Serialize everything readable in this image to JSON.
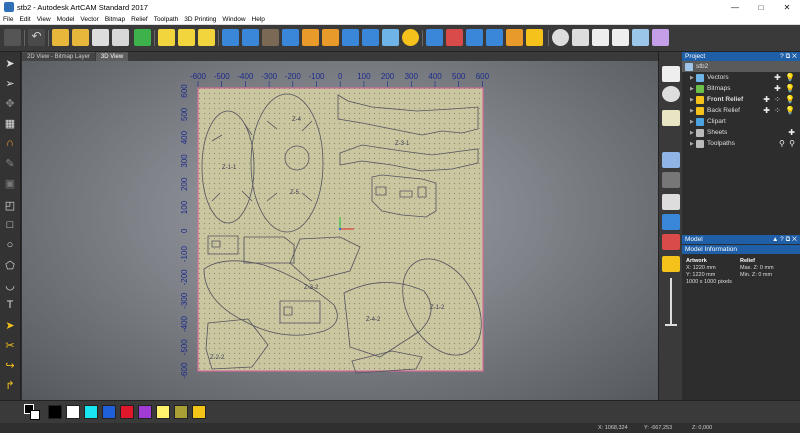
{
  "window": {
    "title": "stb2 - Autodesk ArtCAM Standard 2017"
  },
  "menu": [
    "File",
    "Edit",
    "View",
    "Model",
    "Vector",
    "Bitmap",
    "Relief",
    "Toolpath",
    "3D Printing",
    "Window",
    "Help"
  ],
  "view_tabs": [
    {
      "label": "2D View - Bitmap Layer",
      "active": false
    },
    {
      "label": "3D View",
      "active": true
    }
  ],
  "rulers": {
    "top": [
      "-600",
      "-500",
      "-400",
      "-300",
      "-200",
      "-100",
      "0",
      "100",
      "200",
      "300",
      "400",
      "500",
      "600"
    ],
    "left": [
      "600",
      "500",
      "400",
      "300",
      "200",
      "100",
      "0",
      "-100",
      "-200",
      "-300",
      "-400",
      "-500",
      "-600"
    ]
  },
  "part_labels": [
    "Z-4",
    "Z-1-1",
    "Z-3-1",
    "Z-5",
    "Z-2-2",
    "Z-3-2",
    "Z-4-2",
    "Z-1-2"
  ],
  "project": {
    "header": "Project",
    "header_controls": "? ⧉ ✕",
    "root": "stb2",
    "items": [
      {
        "label": "Vectors",
        "color": "#6fb4e6",
        "bold": false,
        "actions": "✚ 💡"
      },
      {
        "label": "Bitmaps",
        "color": "#6cc04a",
        "bold": false,
        "actions": "✚ 💡"
      },
      {
        "label": "Front Relief",
        "color": "#f5c21b",
        "bold": true,
        "actions": "✚ ⁘ 💡"
      },
      {
        "label": "Back Relief",
        "color": "#f5c21b",
        "bold": false,
        "actions": "✚ ⁘ 💡"
      },
      {
        "label": "Clipart",
        "color": "#4aa3df",
        "bold": false,
        "actions": ""
      },
      {
        "label": "Sheets",
        "color": "#bbbbbb",
        "bold": false,
        "actions": "✚"
      },
      {
        "label": "Toolpaths",
        "color": "#bbbbbb",
        "bold": false,
        "actions": "⚲ ⚲"
      }
    ]
  },
  "model": {
    "header": "Model",
    "header_controls": "▲ ? ⧉ ✕",
    "section_title": "Model Information",
    "artwork": {
      "title": "Artwork",
      "x": "X: 1220 mm",
      "y": "Y: 1220 mm",
      "pixels": "1000 x 1000 pixels"
    },
    "relief": {
      "title": "Relief",
      "max": "Max. Z: 0 mm",
      "min": "Min. Z: 0 mm"
    }
  },
  "palette_colors": [
    "#000000",
    "#ffffff",
    "#18e6f0",
    "#1f5fd8",
    "#e0182a",
    "#a03bd6",
    "#fff36e",
    "#a8a035",
    "#f3c418"
  ],
  "status": {
    "x": "X: 1068,324",
    "y": "Y: -667,253",
    "z": "Z: 0,000"
  }
}
